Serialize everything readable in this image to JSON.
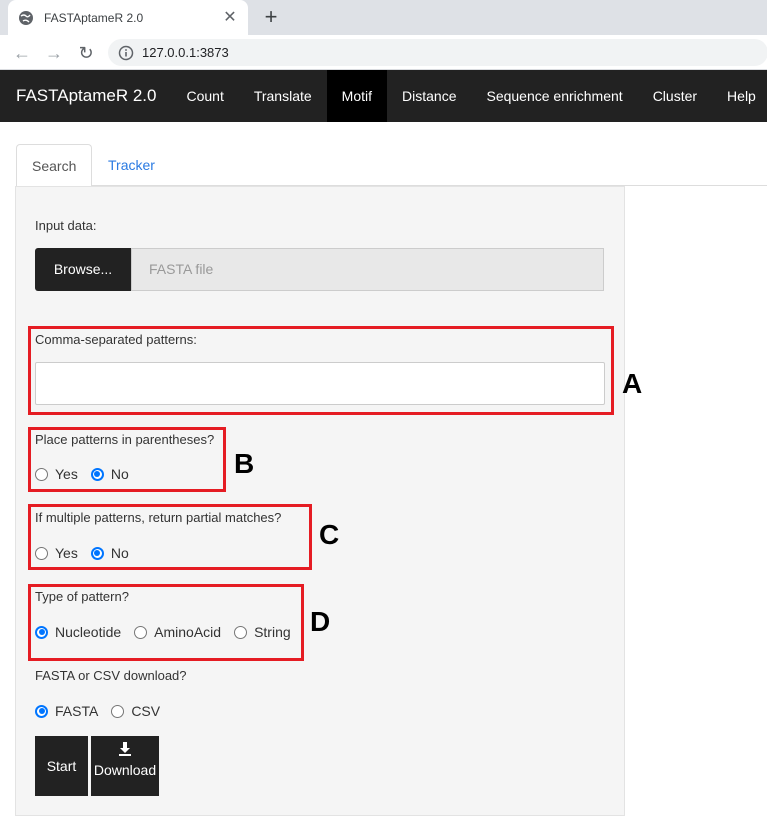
{
  "browser": {
    "tab_title": "FASTAptameR 2.0",
    "url": "127.0.0.1:3873"
  },
  "navbar": {
    "brand": "FASTAptameR 2.0",
    "items": [
      "Count",
      "Translate",
      "Motif",
      "Distance",
      "Sequence enrichment",
      "Cluster",
      "Help"
    ],
    "active": "Motif"
  },
  "tabs": {
    "search": "Search",
    "tracker": "Tracker",
    "active": "Search"
  },
  "form": {
    "input_label": "Input data:",
    "browse_label": "Browse...",
    "file_placeholder": "FASTA file",
    "patterns_label": "Comma-separated patterns:",
    "patterns_value": "",
    "parentheses": {
      "label": "Place patterns in parentheses?",
      "options": [
        "Yes",
        "No"
      ],
      "selected": "No"
    },
    "partial": {
      "label": "If multiple patterns, return partial matches?",
      "options": [
        "Yes",
        "No"
      ],
      "selected": "No"
    },
    "pattern_type": {
      "label": "Type of pattern?",
      "options": [
        "Nucleotide",
        "AminoAcid",
        "String"
      ],
      "selected": "Nucleotide"
    },
    "download_format": {
      "label": "FASTA or CSV download?",
      "options": [
        "FASTA",
        "CSV"
      ],
      "selected": "FASTA"
    },
    "start_label": "Start",
    "download_label": "Download"
  },
  "annotations": [
    "A",
    "B",
    "C",
    "D"
  ],
  "colors": {
    "highlight": "#e51c23",
    "navbar": "#222222",
    "active_nav": "#000000",
    "radio": "#0075ff"
  }
}
